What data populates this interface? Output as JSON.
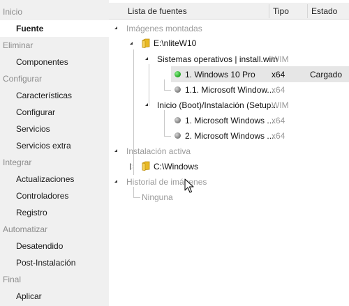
{
  "sidebar": {
    "cat_inicio": "Inicio",
    "item_fuente": "Fuente",
    "cat_eliminar": "Eliminar",
    "item_componentes": "Componentes",
    "cat_configurar": "Configurar",
    "item_caracteristicas": "Características",
    "item_configurar": "Configurar",
    "item_servicios": "Servicios",
    "item_servicios_extra": "Servicios extra",
    "cat_integrar": "Integrar",
    "item_actualizaciones": "Actualizaciones",
    "item_controladores": "Controladores",
    "item_registro": "Registro",
    "cat_automatizar": "Automatizar",
    "item_desatendido": "Desatendido",
    "item_post_instalacion": "Post-Instalación",
    "cat_final": "Final",
    "item_aplicar": "Aplicar"
  },
  "header": {
    "col_sources": "Lista de fuentes",
    "col_type": "Tipo",
    "col_status": "Estado"
  },
  "tree": {
    "mounted_images": "Imágenes montadas",
    "mount_path": "E:\\nliteW10",
    "os_group": "Sistemas operativos  |  install.wim",
    "os_group_type": "WIM",
    "img1_label": "1. Windows 10 Pro",
    "img1_type": "x64",
    "img1_status": "Cargado",
    "img2_label": "1.1. Microsoft Window...",
    "img2_type": "x64",
    "boot_group": "Inicio (Boot)/Instalación (Setup...",
    "boot_group_type": "WIM",
    "boot1_label": "1. Microsoft Windows ...",
    "boot1_type": "x64",
    "boot2_label": "2. Microsoft Windows ...",
    "boot2_type": "x64",
    "active_install": "Instalación activa",
    "active_path": "C:\\Windows",
    "history": "Historial de imágenes",
    "history_none": "Ninguna"
  },
  "colors": {
    "sidebar_bg": "#f0f0f0",
    "category_text": "#8c8c8c",
    "selected_row_bg": "#e6e6e6",
    "loaded_indicator": "#1fa41f",
    "folder_yellow": "#e8b923"
  },
  "icons": [
    "folder-icon",
    "green-dot-icon",
    "grey-dot-icon",
    "expand-arrow-icon",
    "collapse-arrow-icon",
    "mouse-cursor-icon"
  ]
}
